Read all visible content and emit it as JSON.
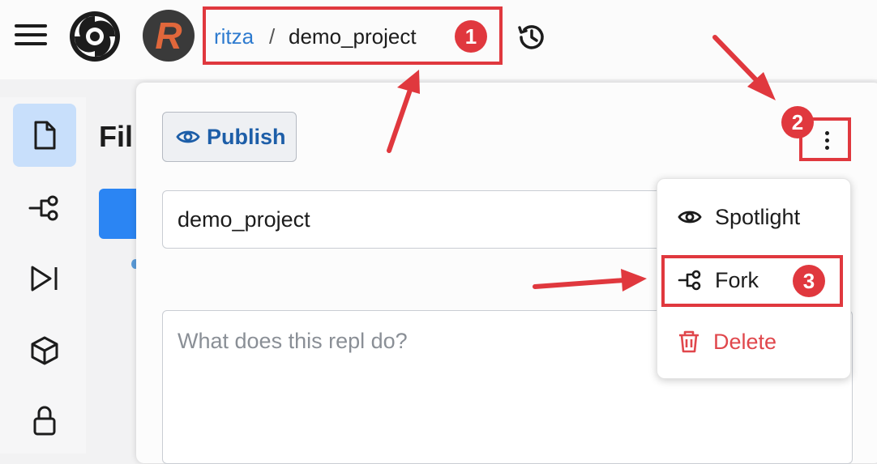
{
  "header": {
    "user": "ritza",
    "separator": "/",
    "repl_name": "demo_project",
    "avatar_letter": "R"
  },
  "sidebar": {
    "files_heading": "Fil"
  },
  "panel": {
    "publish_label": "Publish",
    "name_value": "demo_project",
    "description_placeholder": "What does this repl do?"
  },
  "menu": {
    "items": [
      {
        "label": "Spotlight",
        "icon": "eye-icon"
      },
      {
        "label": "Fork",
        "icon": "fork-icon"
      },
      {
        "label": "Delete",
        "icon": "trash-icon"
      }
    ]
  },
  "annotations": {
    "badges": [
      "1",
      "2",
      "3"
    ],
    "color": "#e0383e"
  },
  "colors": {
    "accent": "#2e7bcf",
    "publish_text": "#1d5ea8",
    "delete": "#e0474c",
    "active_rail": "#c8dffb"
  }
}
